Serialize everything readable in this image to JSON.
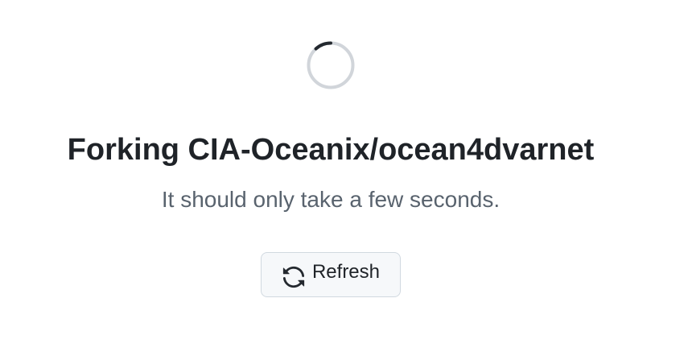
{
  "spinner": {
    "icon": "loading-spinner-icon",
    "track_color": "#d1d5da",
    "arc_color": "#24292f"
  },
  "heading": {
    "title": "Forking CIA-Oceanix/ocean4dvarnet",
    "subtitle": "It should only take a few seconds."
  },
  "actions": {
    "refresh_label": "Refresh",
    "refresh_icon": "sync-icon"
  },
  "colors": {
    "title": "#1f2328",
    "subtitle": "#59636e",
    "button_bg": "#f6f8fa",
    "button_border": "#d1d9e0"
  }
}
